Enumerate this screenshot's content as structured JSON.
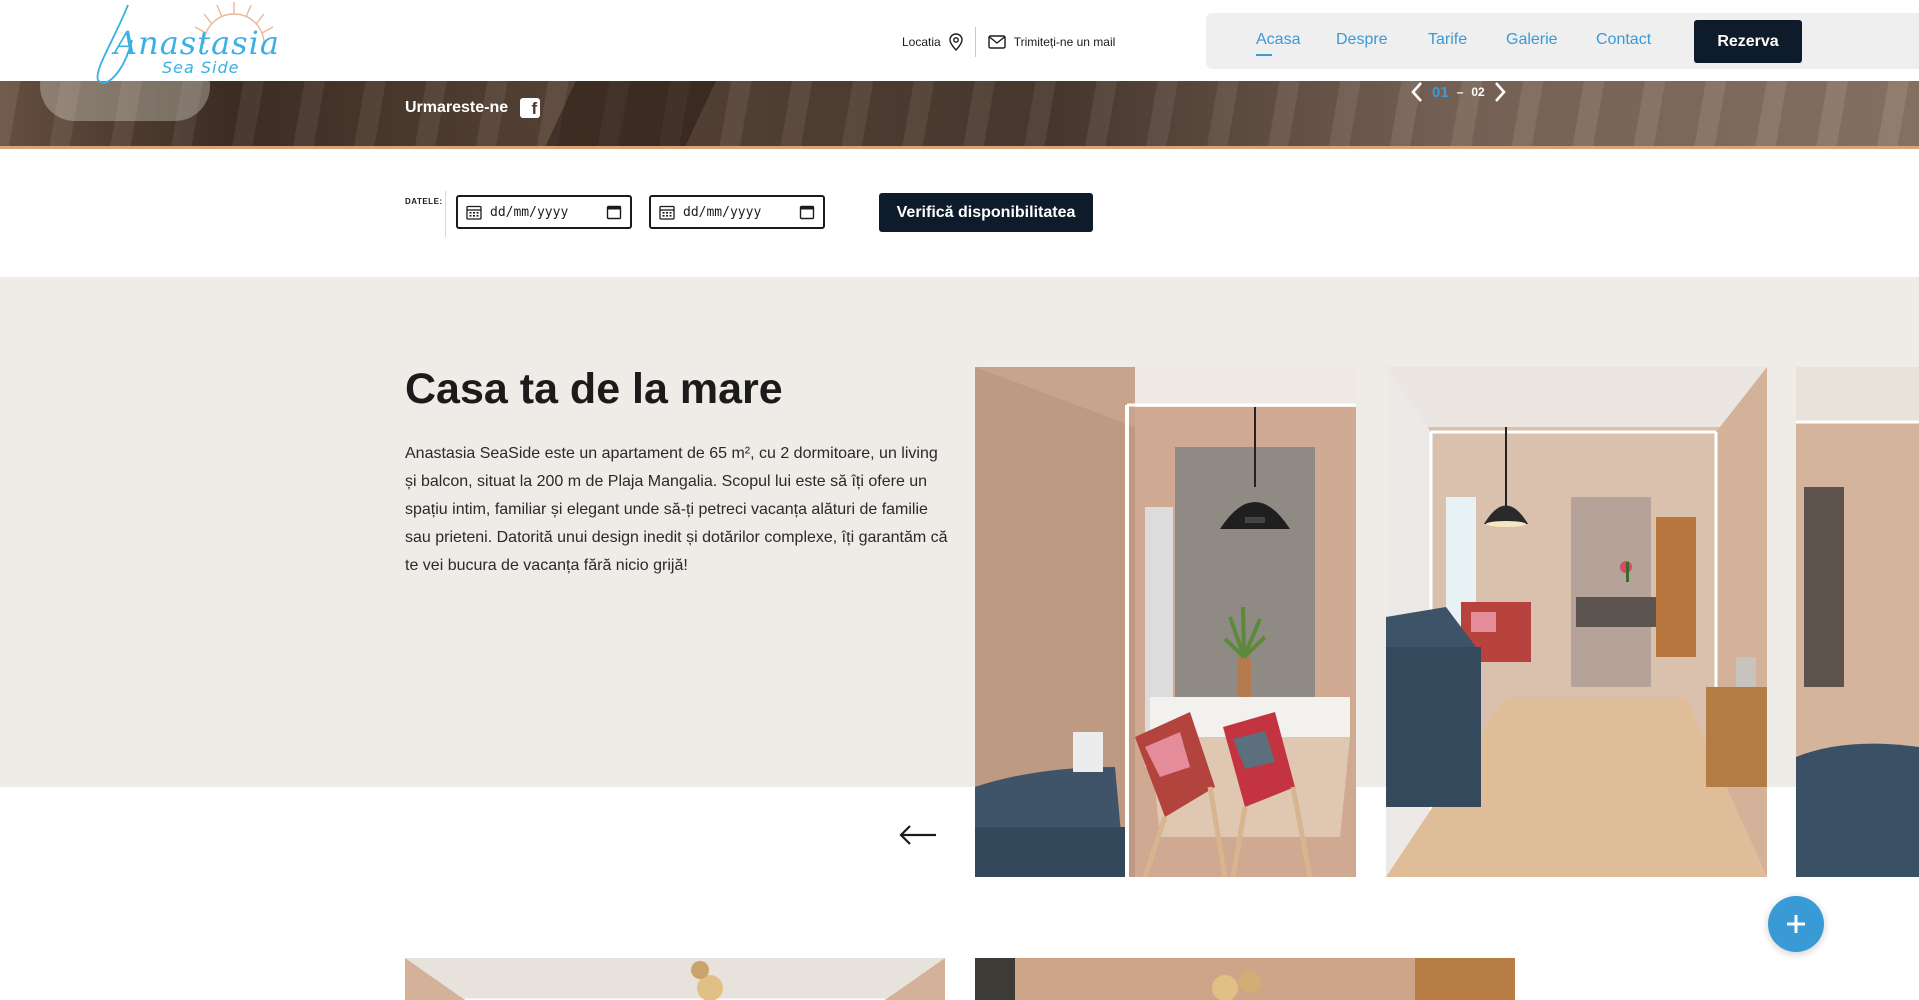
{
  "brand": {
    "name_line1": "Anastasia",
    "name_line2": "Sea Side"
  },
  "header": {
    "location_label": "Locatia",
    "email_label": "Trimiteți-ne un mail",
    "nav": [
      {
        "label": "Acasa",
        "active": true
      },
      {
        "label": "Despre",
        "active": false
      },
      {
        "label": "Tarife",
        "active": false
      },
      {
        "label": "Galerie",
        "active": false
      },
      {
        "label": "Contact",
        "active": false
      }
    ],
    "book_label": "Rezerva"
  },
  "hero": {
    "follow_label": "Urmareste-ne",
    "pager_current": "01",
    "pager_sep": "–",
    "pager_total": "02"
  },
  "booking": {
    "dates_label": "DATELE:",
    "check_in_placeholder": "dd/mm/yyyy",
    "check_out_placeholder": "dd/mm/yyyy",
    "check_button": "Verifică disponibilitatea"
  },
  "about": {
    "title": "Casa ta de la mare",
    "text": "Anastasia SeaSide este un apartament de 65 m², cu 2 dormitoare, un living și balcon, situat la 200 m de Plaja Mangalia. Scopul lui este să îți ofere un spațiu intim, familiar și elegant unde să-ți petreci vacanța alături de familie sau prieteni. Datorită unui design inedit și dotărilor complexe, îți garantăm că te vei bucura de vacanța fără nicio grijă!"
  },
  "colors": {
    "accent_blue": "#3a9ad6",
    "dark_navy": "#0d1b2a",
    "section_beige": "#efebe7"
  },
  "icons": [
    "location-pin-icon",
    "mail-icon",
    "facebook-icon",
    "chevron-left-icon",
    "chevron-right-icon",
    "calendar-icon",
    "arrow-left-icon",
    "plus-icon"
  ]
}
